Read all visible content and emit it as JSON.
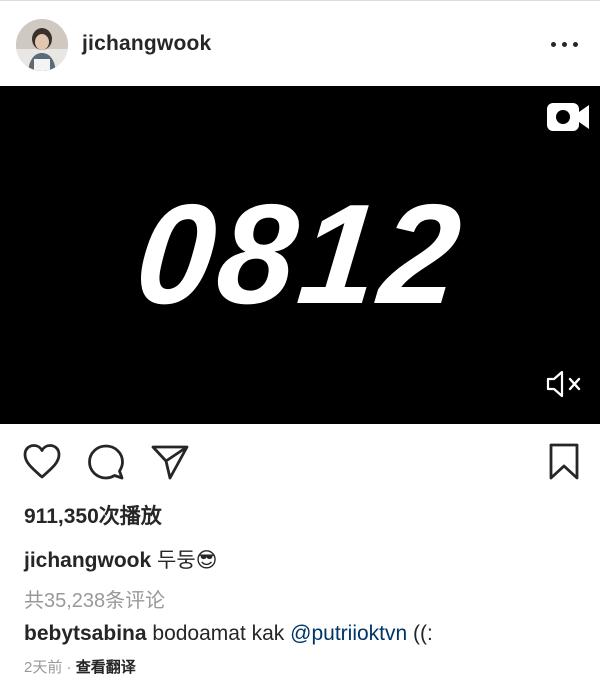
{
  "header": {
    "username": "jichangwook"
  },
  "media": {
    "title": "0812"
  },
  "stats": {
    "views": "911,350次播放"
  },
  "caption": {
    "user": "jichangwook",
    "text": "두둥😎"
  },
  "comments": {
    "view_all": "共35,238条评论",
    "first": {
      "user": "bebytsabina",
      "text_before": "bodoamat kak",
      "mention": "@putriioktvn",
      "text_after": "((:"
    }
  },
  "meta": {
    "time": "2天前",
    "separator": "·",
    "translate": "查看翻译"
  },
  "icons": [
    "avatar",
    "more-icon",
    "video-icon",
    "mute-icon",
    "heart-icon",
    "comment-icon",
    "share-icon",
    "bookmark-icon"
  ]
}
